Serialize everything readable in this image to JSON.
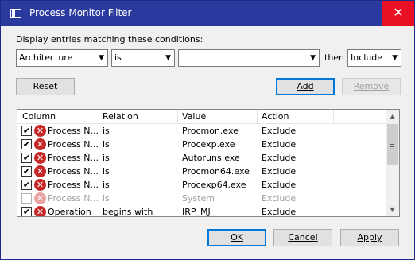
{
  "window": {
    "title": "Process Monitor Filter",
    "close_glyph": "✕"
  },
  "conditions": {
    "label": "Display entries matching these conditions:",
    "column_value": "Architecture",
    "relation_value": "is",
    "value_value": "",
    "then_label": "then",
    "action_value": "Include"
  },
  "buttons": {
    "reset": "Reset",
    "add": "Add",
    "remove": "Remove",
    "ok": "OK",
    "cancel": "Cancel",
    "apply": "Apply"
  },
  "list": {
    "headers": [
      "Column",
      "Relation",
      "Value",
      "Action"
    ],
    "rows": [
      {
        "checked": true,
        "enabled": true,
        "column": "Process N...",
        "relation": "is",
        "value": "Procmon.exe",
        "action": "Exclude"
      },
      {
        "checked": true,
        "enabled": true,
        "column": "Process N...",
        "relation": "is",
        "value": "Procexp.exe",
        "action": "Exclude"
      },
      {
        "checked": true,
        "enabled": true,
        "column": "Process N...",
        "relation": "is",
        "value": "Autoruns.exe",
        "action": "Exclude"
      },
      {
        "checked": true,
        "enabled": true,
        "column": "Process N...",
        "relation": "is",
        "value": "Procmon64.exe",
        "action": "Exclude"
      },
      {
        "checked": true,
        "enabled": true,
        "column": "Process N...",
        "relation": "is",
        "value": "Procexp64.exe",
        "action": "Exclude"
      },
      {
        "checked": false,
        "enabled": false,
        "column": "Process N...",
        "relation": "is",
        "value": "System",
        "action": "Exclude"
      },
      {
        "checked": true,
        "enabled": true,
        "column": "Operation",
        "relation": "begins with",
        "value": "IRP_MJ_",
        "action": "Exclude"
      }
    ]
  },
  "icons": {
    "dropdown": "chevron-down-icon",
    "exclude": "exclude-x-icon",
    "check": "checkmark-icon"
  },
  "colors": {
    "titlebar": "#2b3a9e",
    "close": "#e81123",
    "exclude_icon": "#c62828"
  }
}
